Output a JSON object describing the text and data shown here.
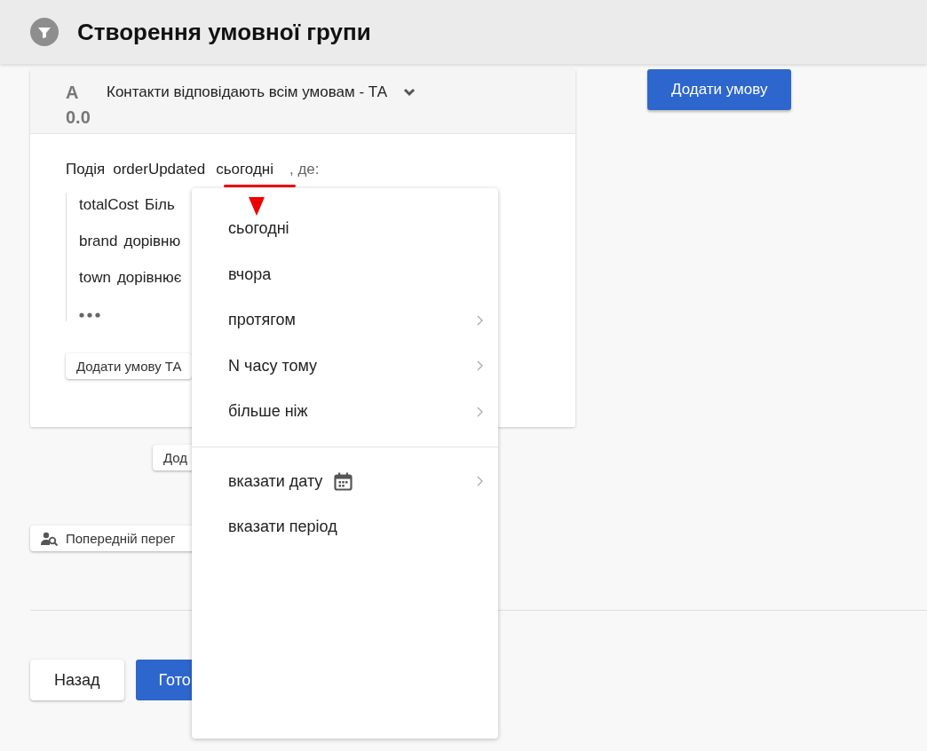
{
  "header": {
    "title": "Створення умовної групи"
  },
  "group": {
    "label_letter": "A",
    "label_number": "0.0",
    "mode": "Контакти відповідають всім умовам - ТА",
    "expanded": false,
    "event": {
      "prefix": "Подія",
      "name": "orderUpdated",
      "period": "сьогодні",
      "suffix": ", де:"
    },
    "conditions": [
      {
        "field": "totalCost",
        "operator": "Біль"
      },
      {
        "field": "brand",
        "operator": "дорівню"
      },
      {
        "field": "town",
        "operator": "дорівнює"
      }
    ],
    "add_condition_button": "Додати умову ТА"
  },
  "add_group_button": "Дод",
  "add_condition_main_button": "Додати умову",
  "preview_button": "Попередній перег",
  "back_button": "Назад",
  "done_button": "Гото",
  "menu": {
    "groups": [
      [
        {
          "label": "сьогодні",
          "kind": "plain",
          "submenu": false
        },
        {
          "label": "вчора",
          "kind": "plain",
          "submenu": false
        },
        {
          "label": "протягом",
          "kind": "plain",
          "submenu": true
        },
        {
          "label": "N часу тому",
          "kind": "plain",
          "submenu": true
        },
        {
          "label": "більше ніж",
          "kind": "plain",
          "submenu": true
        }
      ],
      [
        {
          "label": "вказати дату",
          "kind": "date",
          "submenu": true
        },
        {
          "label": "вказати період",
          "kind": "plain",
          "submenu": false
        }
      ]
    ]
  }
}
